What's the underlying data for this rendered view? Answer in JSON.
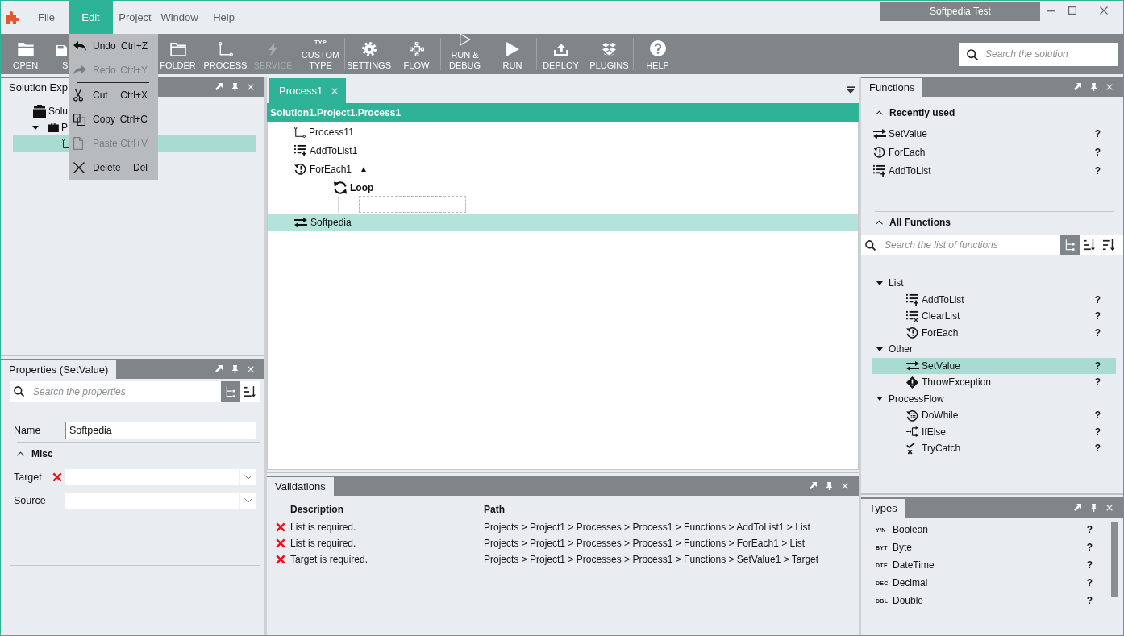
{
  "window": {
    "title": "Softpedia Test"
  },
  "menu_bar": [
    {
      "label": "File",
      "selected": false
    },
    {
      "label": "Edit",
      "selected": true
    },
    {
      "label": "Project",
      "selected": false
    },
    {
      "label": "Window",
      "selected": false
    },
    {
      "label": "Help",
      "selected": false
    }
  ],
  "edit_menu": [
    {
      "kind": "item",
      "label": "Undo",
      "shortcut": "Ctrl+Z",
      "disabled": false
    },
    {
      "kind": "item",
      "label": "Redo",
      "shortcut": "Ctrl+Y",
      "disabled": true
    },
    {
      "kind": "separator"
    },
    {
      "kind": "item",
      "label": "Cut",
      "shortcut": "Ctrl+X",
      "disabled": false
    },
    {
      "kind": "item",
      "label": "Copy",
      "shortcut": "Ctrl+C",
      "disabled": false
    },
    {
      "kind": "item",
      "label": "Paste",
      "shortcut": "Ctrl+V",
      "disabled": true
    },
    {
      "kind": "item",
      "label": "Delete",
      "shortcut": "Del",
      "disabled": false
    }
  ],
  "toolbar": {
    "groups": [
      [
        {
          "kind": "full",
          "label": "OPEN",
          "disabled": false
        },
        {
          "kind": "partial",
          "label": "S",
          "disabled": false
        },
        {
          "kind": "full",
          "label": "FOLDER",
          "disabled": false
        },
        {
          "kind": "full",
          "label": "PROCESS",
          "disabled": false
        },
        {
          "kind": "full",
          "label": "SERVICE",
          "disabled": true
        },
        {
          "kind": "full",
          "label": "CUSTOM TYPE",
          "badge": "TYP",
          "disabled": false
        }
      ],
      [
        {
          "kind": "full",
          "label": "SETTINGS",
          "disabled": false
        },
        {
          "kind": "full",
          "label": "FLOW",
          "disabled": false
        }
      ],
      [
        {
          "kind": "full",
          "label": "RUN & DEBUG",
          "disabled": false
        },
        {
          "kind": "full",
          "label": "RUN",
          "disabled": false
        }
      ],
      [
        {
          "kind": "full",
          "label": "DEPLOY",
          "disabled": false
        }
      ],
      [
        {
          "kind": "full",
          "label": "PLUGINS",
          "disabled": false
        }
      ],
      [
        {
          "kind": "full",
          "label": "HELP",
          "disabled": false
        }
      ]
    ],
    "search": {
      "placeholder": "Search the solution"
    }
  },
  "solution_explorer": {
    "title": "Solution Exp",
    "tree": [
      {
        "label": "Solu",
        "selected": false,
        "children": [
          {
            "label": "P",
            "expanded": true,
            "selected": false,
            "children": [
              {
                "selected": true
              }
            ]
          }
        ]
      }
    ]
  },
  "properties": {
    "title": "Properties (SetValue)",
    "search": {
      "placeholder": "Search the properties"
    },
    "view_buttons": [
      {
        "selected": true
      },
      {
        "selected": false
      }
    ],
    "fields": [
      {
        "label": "Name",
        "value": "Softpedia",
        "focused": true
      }
    ],
    "sections": [
      {
        "title": "Misc",
        "expanded": true,
        "fields": [
          {
            "label": "Target",
            "error": true
          },
          {
            "label": "Source",
            "error": false
          }
        ]
      }
    ]
  },
  "document": {
    "tabs": [
      {
        "label": "Process1",
        "selected": true
      }
    ],
    "breadcrumb": "Solution1.Project1.Process1",
    "nodes": [
      {
        "kind": "step",
        "label": "Process11",
        "selected": false
      },
      {
        "kind": "step",
        "label": "AddToList1",
        "selected": false
      },
      {
        "kind": "step",
        "label": "ForEach1",
        "toggle": "▲",
        "selected": false,
        "children": [
          {
            "kind": "block",
            "label": "Loop",
            "selected": false
          }
        ]
      },
      {
        "kind": "step",
        "label": "Softpedia",
        "selected": true
      }
    ]
  },
  "validations": {
    "title": "Validations",
    "columns": [
      "Description",
      "Path"
    ],
    "rows": [
      {
        "error": true,
        "description": "List is required.",
        "path": "Projects > Project1 > Processes > Process1 > Functions > AddToList1 > List"
      },
      {
        "error": true,
        "description": "List is required.",
        "path": "Projects > Project1 > Processes > Process1 > Functions > ForEach1 > List"
      },
      {
        "error": true,
        "description": "Target is required.",
        "path": "Projects > Project1 > Processes > Process1 > Functions > SetValue1 > Target"
      }
    ]
  },
  "functions": {
    "title": "Functions",
    "recent": {
      "title": "Recently used",
      "expanded": true,
      "items": [
        {
          "label": "SetValue",
          "help": "?"
        },
        {
          "label": "ForEach",
          "help": "?"
        },
        {
          "label": "AddToList",
          "help": "?"
        }
      ]
    },
    "all": {
      "title": "All Functions",
      "expanded": true,
      "search": {
        "placeholder": "Search the list of functions"
      },
      "view_buttons": [
        {
          "selected": true
        },
        {
          "selected": false
        },
        {
          "selected": false
        }
      ],
      "tree": [
        {
          "label": "List",
          "expanded": true,
          "children": [
            {
              "label": "AddToList",
              "help": "?",
              "selected": false
            },
            {
              "label": "ClearList",
              "help": "?",
              "selected": false
            },
            {
              "label": "ForEach",
              "help": "?",
              "selected": false
            }
          ]
        },
        {
          "label": "Other",
          "expanded": true,
          "children": [
            {
              "label": "SetValue",
              "help": "?",
              "selected": true
            },
            {
              "label": "ThrowException",
              "help": "?",
              "selected": false
            }
          ]
        },
        {
          "label": "ProcessFlow",
          "expanded": true,
          "children": [
            {
              "label": "DoWhile",
              "help": "?",
              "selected": false
            },
            {
              "label": "IfElse",
              "help": "?",
              "selected": false
            },
            {
              "label": "TryCatch",
              "help": "?",
              "selected": false
            }
          ]
        }
      ]
    }
  },
  "types": {
    "title": "Types",
    "items": [
      {
        "badge": "Y/N",
        "label": "Boolean",
        "help": "?"
      },
      {
        "badge": "BYT",
        "label": "Byte",
        "help": "?"
      },
      {
        "badge": "DTE",
        "label": "DateTime",
        "help": "?"
      },
      {
        "badge": "DEC",
        "label": "Decimal",
        "help": "?"
      },
      {
        "badge": "DBL",
        "label": "Double",
        "help": "?"
      }
    ]
  }
}
